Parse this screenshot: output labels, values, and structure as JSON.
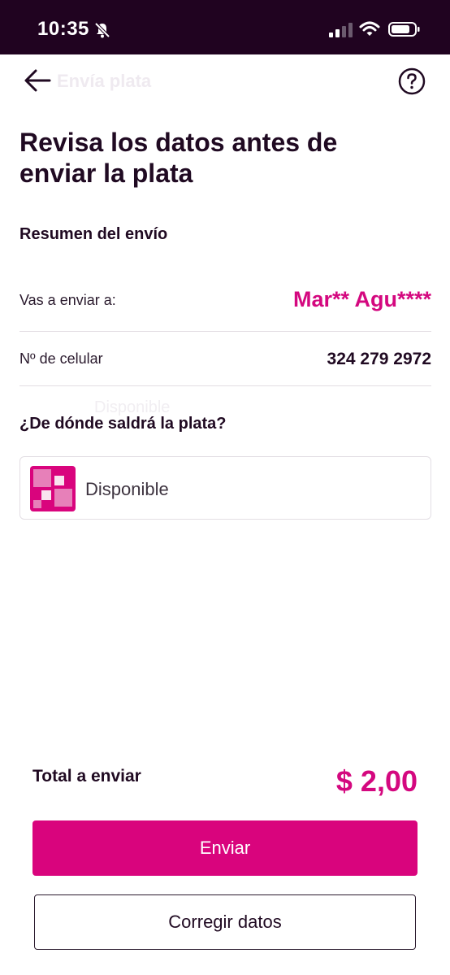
{
  "status_bar": {
    "time": "10:35",
    "icons": [
      "bell-off-icon",
      "signal-icon",
      "wifi-icon",
      "battery-icon"
    ]
  },
  "header": {
    "ghost_title": "Envía plata",
    "back_icon": "arrow-left-icon",
    "help_icon": "question-circle-icon"
  },
  "page": {
    "title": "Revisa los datos antes de enviar la plata",
    "summary_title": "Resumen del envío",
    "recipient_label": "Vas a enviar a:",
    "recipient_value": "Mar** Agu****",
    "phone_label": "Nº de celular",
    "phone_value": "324 279 2972",
    "ghost_row_text": "Disponible",
    "source_title": "¿De dónde saldrá la plata?",
    "source_label": "Disponible",
    "total_label": "Total a enviar",
    "total_amount": "$ 2,00",
    "send_button": "Enviar",
    "correct_button": "Corregir datos"
  },
  "colors": {
    "accent": "#d9047d",
    "status_bar": "#200320",
    "text_dark": "#200a22"
  }
}
